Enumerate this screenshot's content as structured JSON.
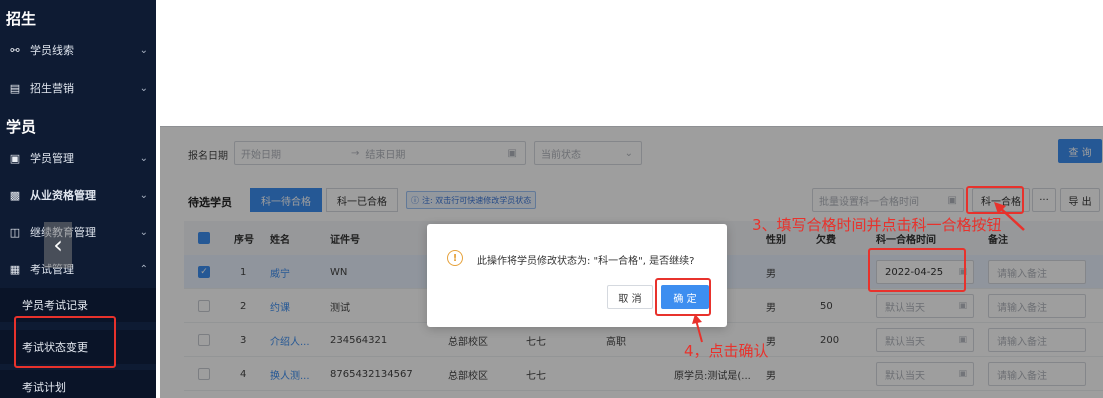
{
  "sidebar": {
    "section_enroll": "招生",
    "section_student": "学员",
    "items": [
      {
        "label": "学员线索",
        "icon": "link-icon"
      },
      {
        "label": "招生营销",
        "icon": "shop-icon"
      },
      {
        "label": "学员管理",
        "icon": "card-icon"
      },
      {
        "label": "从业资格管理",
        "icon": "badge-icon"
      },
      {
        "label": "继续教育管理",
        "icon": "book-icon"
      },
      {
        "label": "考试管理",
        "icon": "exam-icon"
      }
    ],
    "sub_items": [
      "学员考试记录",
      "考试状态变更",
      "考试计划"
    ]
  },
  "filters": {
    "reg_date_label": "报名日期",
    "start_placeholder": "开始日期",
    "arrow": "→",
    "end_placeholder": "结束日期",
    "status_placeholder": "当前状态",
    "query_button": "查 询"
  },
  "toolbar": {
    "title": "待选学员",
    "tab_pending": "科一待合格",
    "tab_passed": "科一已合格",
    "note": "注: 双击行可快速修改学员状态",
    "batch_placeholder": "批量设置科一合格时间",
    "pass_button": "科一合格",
    "more_button": "···",
    "export_button": "导 出"
  },
  "table": {
    "headers": [
      "序号",
      "姓名",
      "证件号",
      "性别",
      "欠费",
      "科一合格时间",
      "备注"
    ],
    "rows": [
      {
        "no": "1",
        "name": "威宁",
        "id": "WN",
        "school": "",
        "coach": "",
        "edu": "",
        "extra": "",
        "gender": "男",
        "owe": "",
        "date": "2022-04-25",
        "remark": "请输入备注",
        "selected": true
      },
      {
        "no": "2",
        "name": "约课",
        "id": "测试",
        "school": "",
        "coach": "",
        "edu": "",
        "extra": "",
        "gender": "男",
        "owe": "50",
        "date": "默认当天",
        "remark": "请输入备注",
        "selected": false
      },
      {
        "no": "3",
        "name": "介绍人...",
        "id": "234564321",
        "school": "总部校区",
        "coach": "七七",
        "edu": "高职",
        "extra": "",
        "gender": "男",
        "owe": "200",
        "date": "默认当天",
        "remark": "请输入备注",
        "selected": false
      },
      {
        "no": "4",
        "name": "换人测...",
        "id": "8765432134567",
        "school": "总部校区",
        "coach": "七七",
        "edu": "",
        "extra": "原学员:测试是(...",
        "gender": "男",
        "owe": "",
        "date": "默认当天",
        "remark": "请输入备注",
        "selected": false
      }
    ]
  },
  "dialog": {
    "icon": "warning-icon",
    "message": "此操作将学员修改状态为: \"科一合格\", 是否继续?",
    "cancel": "取 消",
    "confirm": "确 定"
  },
  "annotations": {
    "step3": "3、填写合格时间并点击科一合格按钮",
    "step4": "4，点击确认"
  },
  "colors": {
    "primary": "#3d8ef0",
    "sidebar": "#0e1b33",
    "annotation": "#e8322c"
  }
}
